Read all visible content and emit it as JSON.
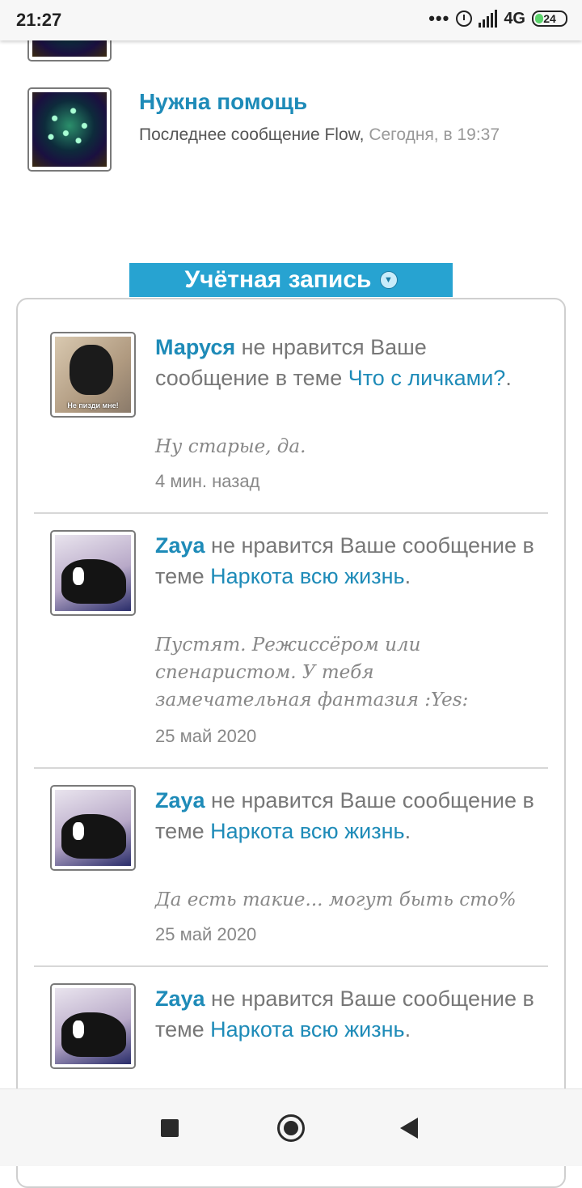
{
  "status_bar": {
    "time": "21:27",
    "dots": "•••",
    "network": "4G",
    "battery": "24"
  },
  "forum": {
    "title": "Нужна помощь",
    "last_message_prefix": "Последнее сообщение Flow, ",
    "last_message_time": "Сегодня, в 19:37"
  },
  "account": {
    "header": "Учётная запись"
  },
  "notifications": [
    {
      "user": "Маруся",
      "action": " не нравится Ваше сообщение в теме ",
      "thread": "Что с личками?",
      "end": ".",
      "quote": "Ну старые, да.",
      "time": "4 мин. назад",
      "avatar_caption": "Не пизди мне!"
    },
    {
      "user": "Zaya",
      "action": " не нравится Ваше сообщение в теме ",
      "thread": "Наркота всю жизнь",
      "end": ".",
      "quote": "Пустят. Режиссёром или спенаристом. У тебя замечательная фантазия :Yes:",
      "time": "25 май 2020"
    },
    {
      "user": "Zaya",
      "action": " не нравится Ваше сообщение в теме ",
      "thread": "Наркота всю жизнь",
      "end": ".",
      "quote": "Да есть такие... могут быть сто%",
      "time": "25 май 2020"
    },
    {
      "user": "Zaya",
      "action": " не нравится Ваше сообщение в теме ",
      "thread": "Наркота всю жизнь",
      "end": "."
    }
  ],
  "icons": {
    "account_toggle": "chevron-down-icon",
    "nav_recents": "square-icon",
    "nav_home": "circle-icon",
    "nav_back": "triangle-back-icon"
  },
  "colors": {
    "accent": "#27a3d1",
    "link": "#1e8bb8"
  }
}
